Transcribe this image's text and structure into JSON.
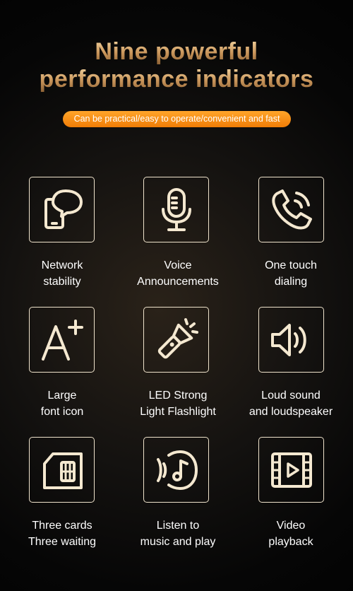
{
  "header": {
    "title_line1": "Nine powerful",
    "title_line2": "performance indicators",
    "subtitle": "Can be practical/easy to operate/convenient and fast"
  },
  "features": [
    {
      "icon": "network-stability-icon",
      "label": "Network\nstability"
    },
    {
      "icon": "microphone-icon",
      "label": "Voice\nAnnouncements"
    },
    {
      "icon": "phone-icon",
      "label": "One touch\ndialing"
    },
    {
      "icon": "large-font-icon",
      "label": "Large\nfont icon"
    },
    {
      "icon": "flashlight-icon",
      "label": "LED Strong\nLight Flashlight"
    },
    {
      "icon": "speaker-icon",
      "label": "Loud sound\nand loudspeaker"
    },
    {
      "icon": "sim-card-icon",
      "label": "Three cards\nThree waiting"
    },
    {
      "icon": "music-icon",
      "label": "Listen to\nmusic and play"
    },
    {
      "icon": "video-icon",
      "label": "Video\nplayback"
    }
  ],
  "colors": {
    "accent": "#f4890f",
    "title_gold": "#d9a66b",
    "icon": "#f4e8d0"
  }
}
